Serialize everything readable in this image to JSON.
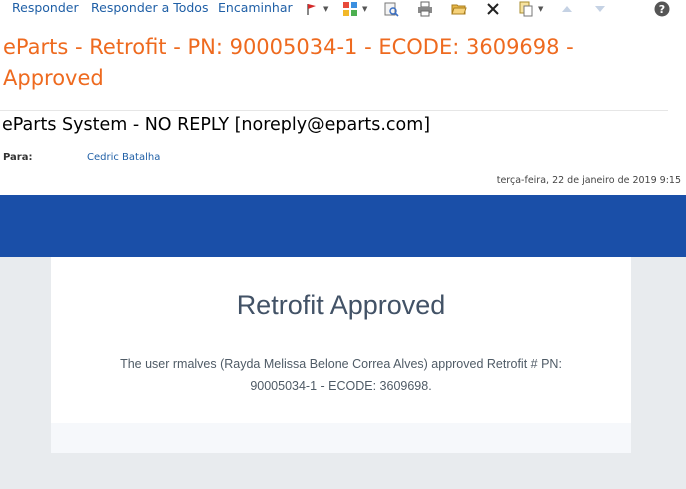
{
  "toolbar": {
    "reply": "Responder",
    "reply_all": "Responder a Todos",
    "forward": "Encaminhar",
    "icons": [
      "flag-icon",
      "categorize-icon",
      "print-preview-icon",
      "print-icon",
      "open-folder-icon",
      "delete-icon",
      "move-icon",
      "previous-icon",
      "next-icon",
      "help-icon"
    ],
    "colors": {
      "link": "#1f5fa6",
      "flag": "#d42a2a"
    }
  },
  "message": {
    "subject": "eParts - Retrofit - PN: 90005034-1 - ECODE: 3609698 - Approved",
    "sender": "eParts System - NO REPLY [noreply@eparts.com]",
    "to_label": "Para:",
    "to_value": "Cedric Batalha",
    "datetime": "terça-feira, 22 de janeiro de 2019 9:15"
  },
  "email_body": {
    "banner_color": "#1a4fa8",
    "title": "Retrofit Approved",
    "text": "The user rmalves (Rayda Melissa Belone Correa Alves) approved Retrofit # PN: 90005034-1 - ECODE: 3609698."
  }
}
